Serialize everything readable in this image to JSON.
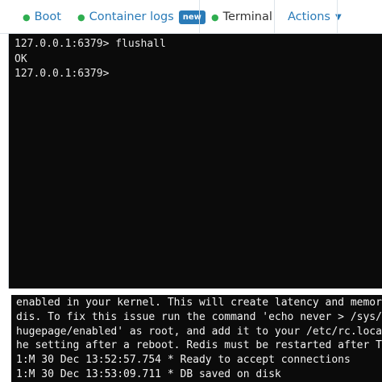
{
  "tabs": [
    {
      "label": "Boot",
      "status": "running"
    },
    {
      "label": "Container logs",
      "badge": "new",
      "status": "running"
    },
    {
      "label": "Terminal",
      "status": "running",
      "active": true
    },
    {
      "label": "Actions",
      "menu": true
    }
  ],
  "terminal": {
    "lines": [
      "127.0.0.1:6379> flushall",
      "OK",
      "127.0.0.1:6379>"
    ]
  },
  "logs": {
    "lines": [
      "enabled in your kernel. This will create latency and memory",
      "dis. To fix this issue run the command 'echo never > /sys/ke",
      "hugepage/enabled' as root, and add it to your /etc/rc.local",
      "he setting after a reboot. Redis must be restarted after THP",
      "1:M 30 Dec 13:52:57.754 * Ready to accept connections",
      "1:M 30 Dec 13:53:09.711 * DB saved on disk"
    ]
  },
  "colors": {
    "accent": "#2a7bb8",
    "status_dot": "#2fae50",
    "terminal_bg": "#0b0b0b"
  }
}
